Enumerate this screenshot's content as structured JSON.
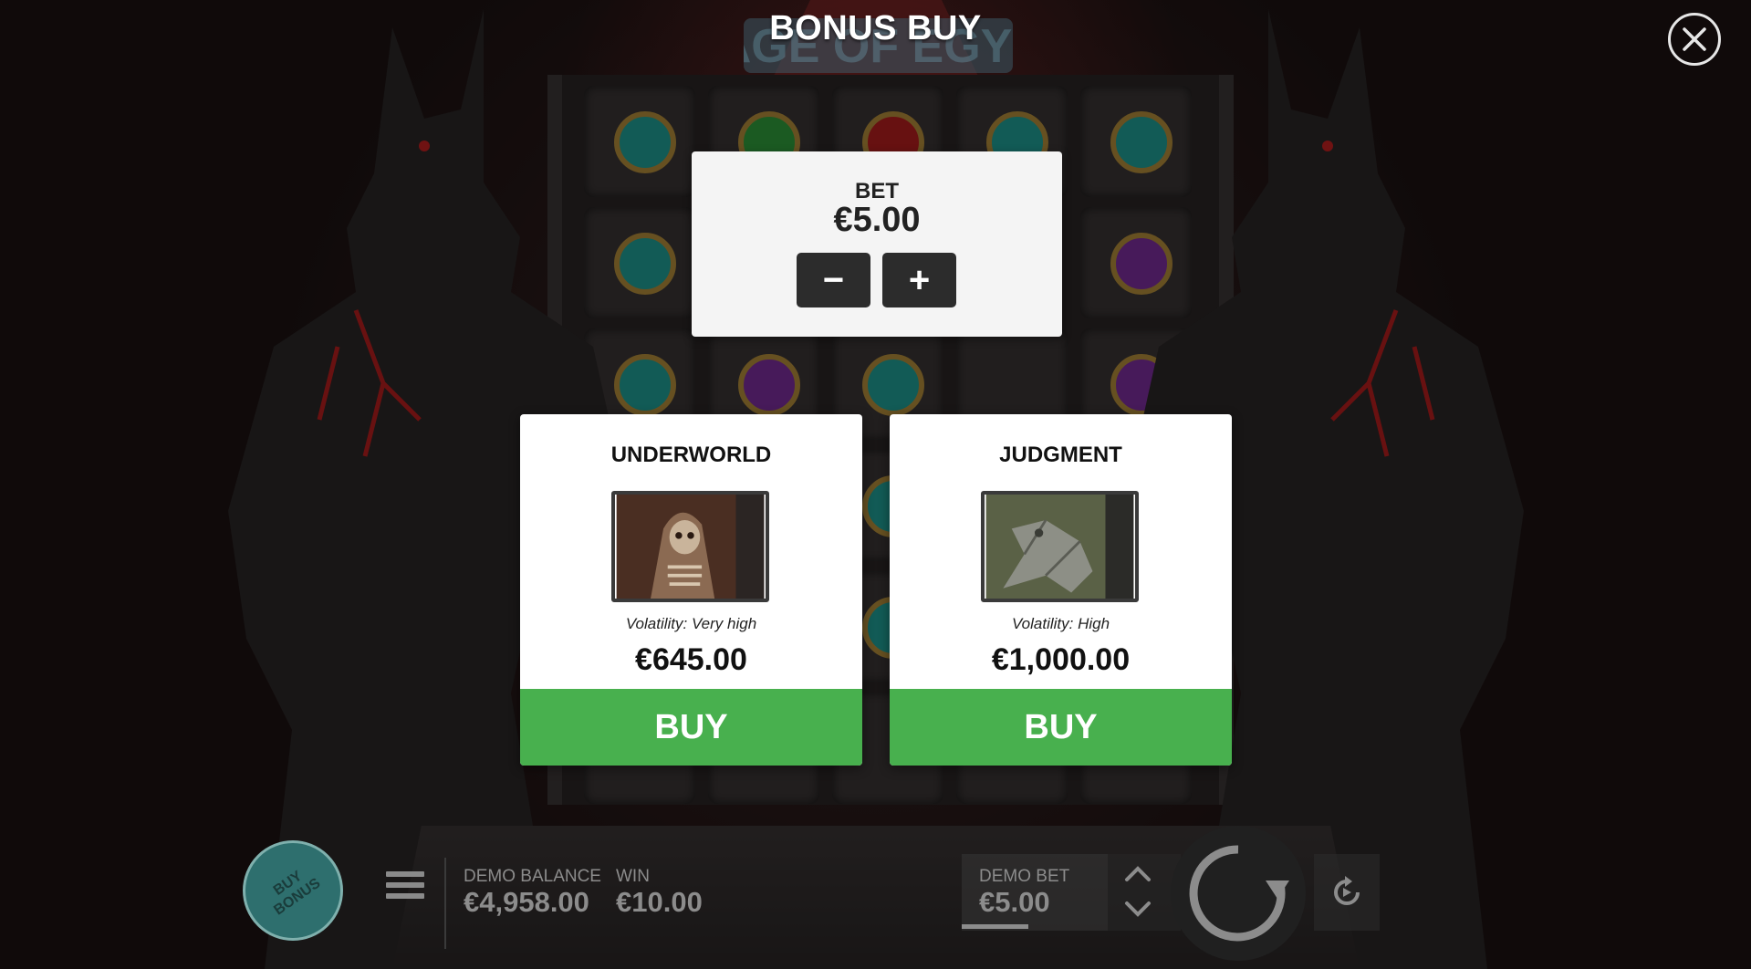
{
  "game": {
    "logo_text": "RAGE OF EGYPT"
  },
  "dialog": {
    "title": "BONUS BUY",
    "close_icon": "close-icon"
  },
  "bet_panel": {
    "label": "BET",
    "value": "€5.00",
    "decrease_label": "−",
    "increase_label": "+"
  },
  "bonuses": [
    {
      "title": "UNDERWORLD",
      "image": "skeleton-reaper-image",
      "volatility": "Volatility: Very high",
      "price": "€645.00",
      "buy_label": "BUY"
    },
    {
      "title": "JUDGMENT",
      "image": "stone-creature-image",
      "volatility": "Volatility: High",
      "price": "€1,000.00",
      "buy_label": "BUY"
    }
  ],
  "bottom_bar": {
    "buy_bonus_label": "BUY BONUS",
    "balance_label": "DEMO BALANCE",
    "balance_value": "€4,958.00",
    "win_label": "WIN",
    "win_value": "€10.00",
    "bet_label": "DEMO BET",
    "bet_value": "€5.00"
  },
  "colors": {
    "buy_green": "#48b04e",
    "panel_white": "#f4f4f4",
    "muted_text": "#8c8c8c",
    "bonus_teal": "#2e6f6e"
  }
}
